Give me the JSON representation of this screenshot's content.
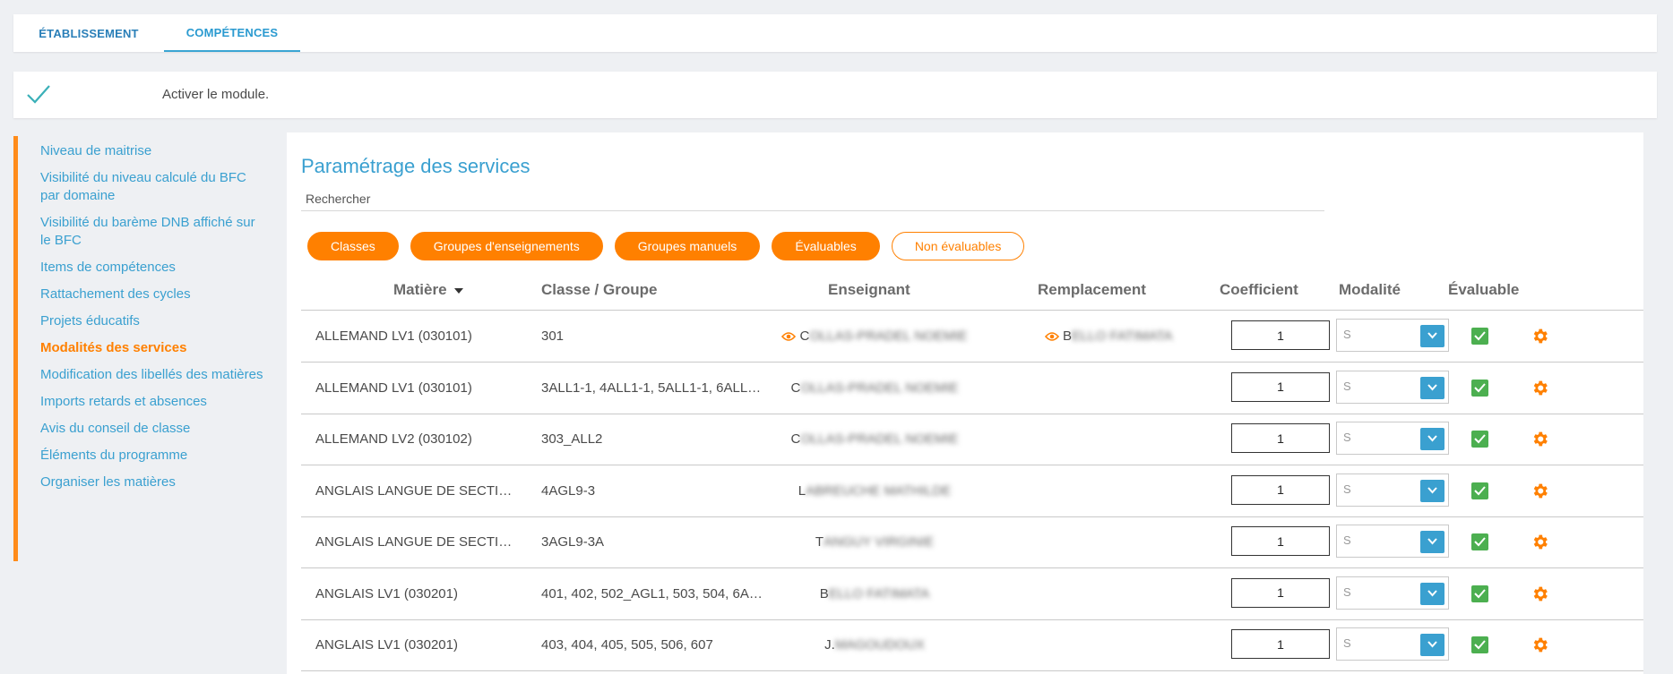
{
  "tabs": [
    {
      "label": "ÉTABLISSEMENT"
    },
    {
      "label": "COMPÉTENCES"
    }
  ],
  "activation": {
    "label": "Activer le module."
  },
  "sidebar": {
    "items": [
      {
        "label": "Niveau de maitrise"
      },
      {
        "label": "Visibilité du niveau calculé du BFC par domaine"
      },
      {
        "label": "Visibilité du barème DNB affiché sur le BFC"
      },
      {
        "label": "Items de compétences"
      },
      {
        "label": "Rattachement des cycles"
      },
      {
        "label": "Projets éducatifs"
      },
      {
        "label": "Modalités des services"
      },
      {
        "label": "Modification des libellés des matières"
      },
      {
        "label": "Imports retards et absences"
      },
      {
        "label": "Avis du conseil de classe"
      },
      {
        "label": "Éléments du programme"
      },
      {
        "label": "Organiser les matières"
      }
    ],
    "active_index": 6
  },
  "panel": {
    "title": "Paramétrage des services",
    "search_placeholder": "Rechercher",
    "filters": [
      {
        "label": "Classes"
      },
      {
        "label": "Groupes d'enseignements"
      },
      {
        "label": "Groupes manuels"
      },
      {
        "label": "Évaluables"
      },
      {
        "label": "Non évaluables"
      }
    ]
  },
  "table": {
    "headers": {
      "matiere": "Matière",
      "classe": "Classe / Groupe",
      "enseignant": "Enseignant",
      "remplacement": "Remplacement",
      "coefficient": "Coefficient",
      "modalite": "Modalité",
      "evaluable": "Évaluable"
    },
    "rows": [
      {
        "matiere": "ALLEMAND LV1 (030101)",
        "classe": "301",
        "ens_initial": "C",
        "ens_rest": "OLLAS-PRADEL NOEMIE",
        "ens_eye": true,
        "rep_initial": "B",
        "rep_rest": "ELLO FATIMATA",
        "coef": "1",
        "modalite": "S"
      },
      {
        "matiere": "ALLEMAND LV1 (030101)",
        "classe": "3ALL1-1, 4ALL1-1, 5ALL1-1, 6ALL…",
        "ens_initial": "C",
        "ens_rest": "OLLAS-PRADEL NOEMIE",
        "ens_eye": false,
        "rep_initial": "",
        "rep_rest": "",
        "coef": "1",
        "modalite": "S"
      },
      {
        "matiere": "ALLEMAND LV2 (030102)",
        "classe": "303_ALL2",
        "ens_initial": "C",
        "ens_rest": "OLLAS-PRADEL NOEMIE",
        "ens_eye": false,
        "rep_initial": "",
        "rep_rest": "",
        "coef": "1",
        "modalite": "S"
      },
      {
        "matiere": "ANGLAIS LANGUE DE SECTION (…",
        "classe": "4AGL9-3",
        "ens_initial": "L",
        "ens_rest": "ABREUCHE MATHILDE",
        "ens_eye": false,
        "rep_initial": "",
        "rep_rest": "",
        "coef": "1",
        "modalite": "S"
      },
      {
        "matiere": "ANGLAIS LANGUE DE SECTION (…",
        "classe": "3AGL9-3A",
        "ens_initial": "T",
        "ens_rest": "ANGUY VIRGINIE",
        "ens_eye": false,
        "rep_initial": "",
        "rep_rest": "",
        "coef": "1",
        "modalite": "S"
      },
      {
        "matiere": "ANGLAIS LV1 (030201)",
        "classe": "401, 402, 502_AGL1, 503, 504, 6A…",
        "ens_initial": "B",
        "ens_rest": "ELLO FATIMATA",
        "ens_eye": false,
        "rep_initial": "",
        "rep_rest": "",
        "coef": "1",
        "modalite": "S"
      },
      {
        "matiere": "ANGLAIS LV1 (030201)",
        "classe": "403, 404, 405, 505, 506, 607",
        "ens_initial": "J. ",
        "ens_rest": "MAGOUDOUX",
        "ens_eye": false,
        "rep_initial": "",
        "rep_rest": "",
        "coef": "1",
        "modalite": "S"
      }
    ]
  },
  "colors": {
    "accent_orange": "#ff8000",
    "link_blue": "#3aa0d0",
    "check_green": "#4caf50"
  }
}
